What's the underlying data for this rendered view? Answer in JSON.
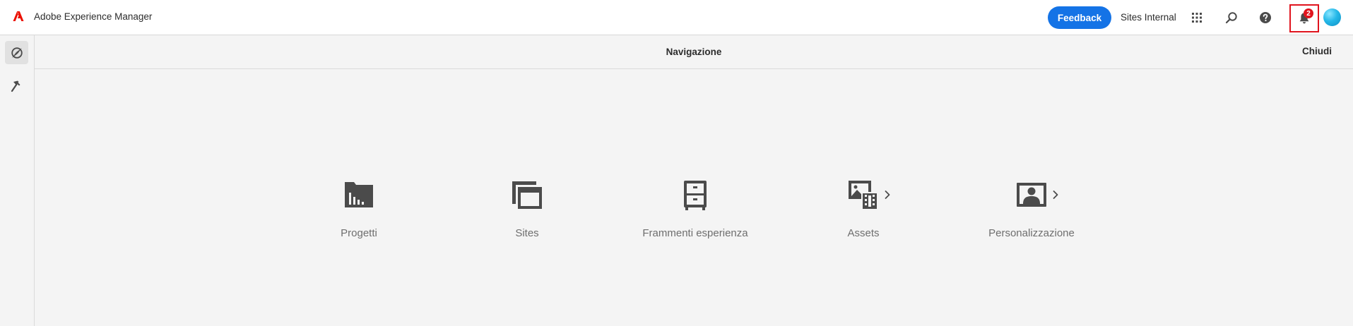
{
  "header": {
    "product_title": "Adobe Experience Manager",
    "feedback_label": "Feedback",
    "org_label": "Sites Internal",
    "notifications_count": "2"
  },
  "rail": {
    "items": [
      {
        "icon": "navigation-compass-icon",
        "active": true
      },
      {
        "icon": "hammer-tools-icon",
        "active": false
      }
    ]
  },
  "navigation": {
    "title": "Navigazione",
    "close_label": "Chiudi",
    "tiles": [
      {
        "label": "Progetti",
        "icon": "projects-folder-icon",
        "has_submenu": false
      },
      {
        "label": "Sites",
        "icon": "sites-windows-icon",
        "has_submenu": false
      },
      {
        "label": "Frammenti esperienza",
        "icon": "experience-fragments-cabinet-icon",
        "has_submenu": false
      },
      {
        "label": "Assets",
        "icon": "assets-images-icon",
        "has_submenu": true
      },
      {
        "label": "Personalizzazione",
        "icon": "personalization-person-icon",
        "has_submenu": true
      }
    ]
  },
  "colors": {
    "accent_blue": "#1473e6",
    "adobe_red": "#eb1000",
    "highlight_red": "#e0141e",
    "icon_gray": "#4b4b4b",
    "background": "#f4f4f4"
  }
}
